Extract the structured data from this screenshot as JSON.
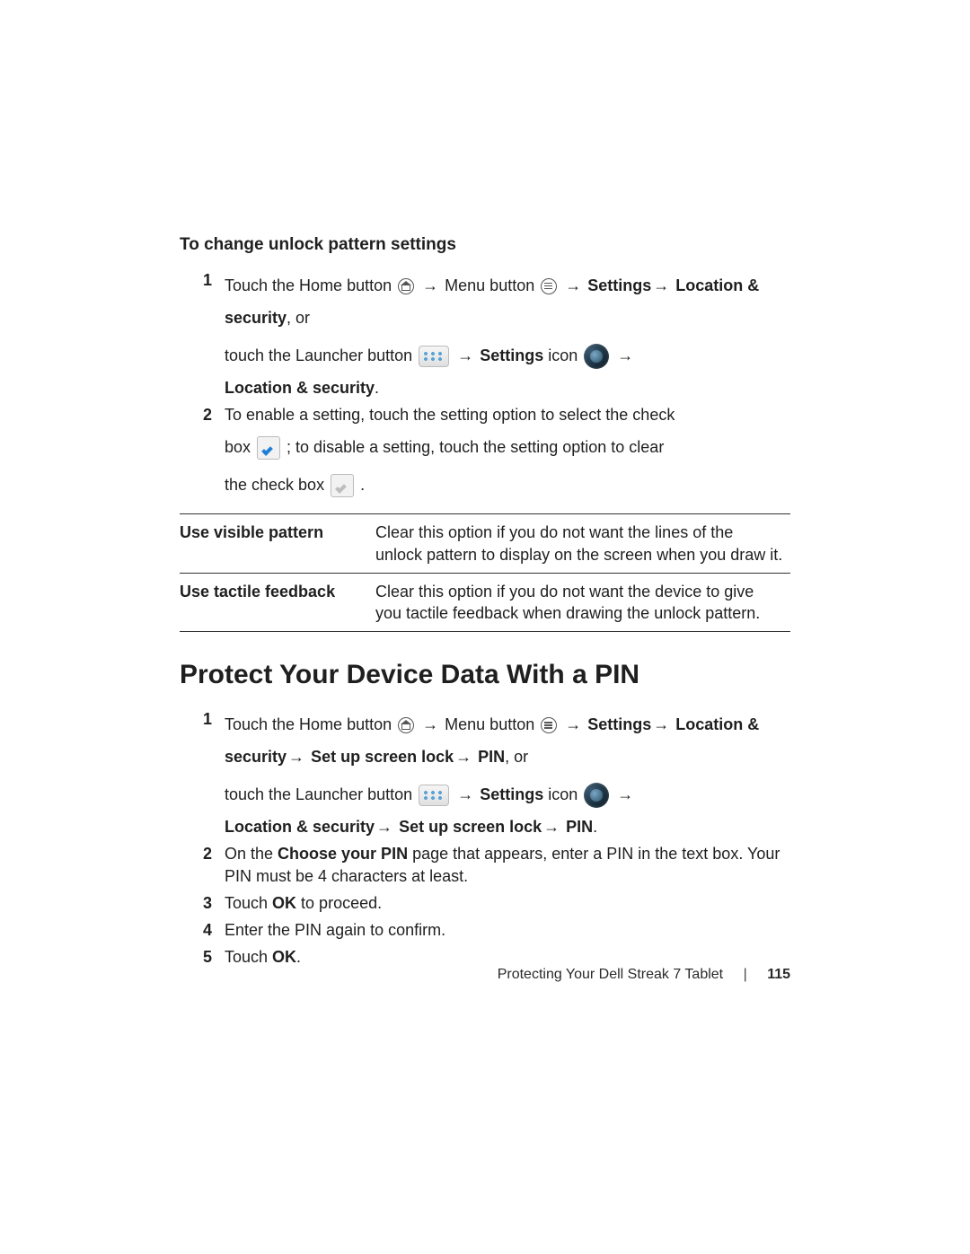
{
  "section1": {
    "heading": "To change unlock pattern settings",
    "step1": {
      "num": "1",
      "l1a": "Touch the Home button ",
      "l1b": " Menu button ",
      "l1c": " Settings",
      "l2a": "Location & security",
      "l2b": ", or",
      "l3a": "touch the Launcher button ",
      "l3b": " Settings",
      "l3c": " icon ",
      "l4": "Location & security",
      "period": "."
    },
    "step2": {
      "num": "2",
      "l1": "To enable a setting, touch the setting option to select the check",
      "l2a": "box ",
      "l2b": " ; to disable a setting, touch the setting option to clear",
      "l3a": "the check box ",
      "l3b": " ."
    },
    "table": {
      "r1label": "Use visible pattern",
      "r1desc": "Clear this option if you do not want the lines of the unlock pattern to display on the screen when you draw it.",
      "r2label": "Use tactile feedback",
      "r2desc": "Clear this option if you do not want the device to give you tactile feedback when drawing the unlock pattern."
    }
  },
  "section2": {
    "heading": "Protect Your Device Data With a PIN",
    "step1": {
      "num": "1",
      "l1a": "Touch the Home button ",
      "l1b": " Menu button ",
      "l1c": " Settings",
      "l2a": "Location & security",
      "l2b": " Set up screen lock",
      "l2c": " PIN",
      "l2d": ", or",
      "l3a": "touch the Launcher button ",
      "l3b": " Settings",
      "l3c": " icon ",
      "l4a": "Location & security",
      "l4b": " Set up screen lock",
      "l4c": " PIN",
      "period": "."
    },
    "step2": {
      "num": "2",
      "l1a": "On the ",
      "l1b": "Choose your PIN",
      "l1c": " page that appears, enter a PIN in the text box. Your PIN must be 4 characters at least."
    },
    "step3": {
      "num": "3",
      "a": "Touch ",
      "b": "OK",
      "c": " to proceed."
    },
    "step4": {
      "num": "4",
      "text": "Enter the PIN again to confirm."
    },
    "step5": {
      "num": "5",
      "a": "Touch ",
      "b": "OK",
      "c": "."
    }
  },
  "arrow": "→",
  "footer": {
    "title": "Protecting Your Dell Streak 7 Tablet",
    "page": "115"
  }
}
